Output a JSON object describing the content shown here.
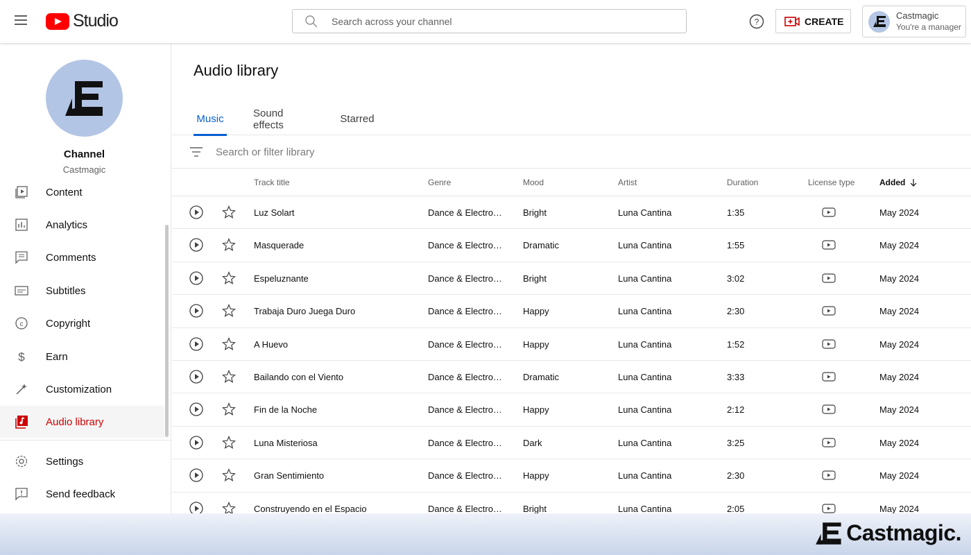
{
  "header": {
    "logo_text": "Studio",
    "search_placeholder": "Search across your channel",
    "create_label": "CREATE",
    "account_name": "Castmagic",
    "account_role": "You're a manager"
  },
  "sidebar": {
    "channel_title": "Channel",
    "channel_name": "Castmagic",
    "items": [
      {
        "label": "Content",
        "icon": "content-icon"
      },
      {
        "label": "Analytics",
        "icon": "analytics-icon"
      },
      {
        "label": "Comments",
        "icon": "comments-icon"
      },
      {
        "label": "Subtitles",
        "icon": "subtitles-icon"
      },
      {
        "label": "Copyright",
        "icon": "copyright-icon"
      },
      {
        "label": "Earn",
        "icon": "dollar-icon"
      },
      {
        "label": "Customization",
        "icon": "magic-wand-icon"
      },
      {
        "label": "Audio library",
        "icon": "audio-library-icon",
        "active": true
      },
      {
        "label": "Settings",
        "icon": "gear-icon"
      },
      {
        "label": "Send feedback",
        "icon": "feedback-icon"
      }
    ]
  },
  "main": {
    "page_title": "Audio library",
    "tabs": [
      {
        "label": "Music",
        "active": true
      },
      {
        "label": "Sound effects"
      },
      {
        "label": "Starred"
      }
    ],
    "filter_placeholder": "Search or filter library",
    "columns": [
      "Track title",
      "Genre",
      "Mood",
      "Artist",
      "Duration",
      "License type",
      "Added"
    ],
    "sorted_column": "Added",
    "tracks": [
      {
        "title": "Luz Solart",
        "genre": "Dance & Electro…",
        "mood": "Bright",
        "artist": "Luna Cantina",
        "duration": "1:35",
        "added": "May 2024"
      },
      {
        "title": "Masquerade",
        "genre": "Dance & Electro…",
        "mood": "Dramatic",
        "artist": "Luna Cantina",
        "duration": "1:55",
        "added": "May 2024"
      },
      {
        "title": "Espeluznante",
        "genre": "Dance & Electro…",
        "mood": "Bright",
        "artist": "Luna Cantina",
        "duration": "3:02",
        "added": "May 2024"
      },
      {
        "title": "Trabaja Duro Juega Duro",
        "genre": "Dance & Electro…",
        "mood": "Happy",
        "artist": "Luna Cantina",
        "duration": "2:30",
        "added": "May 2024"
      },
      {
        "title": "A Huevo",
        "genre": "Dance & Electro…",
        "mood": "Happy",
        "artist": "Luna Cantina",
        "duration": "1:52",
        "added": "May 2024"
      },
      {
        "title": "Bailando con el Viento",
        "genre": "Dance & Electro…",
        "mood": "Dramatic",
        "artist": "Luna Cantina",
        "duration": "3:33",
        "added": "May 2024"
      },
      {
        "title": "Fin de la Noche",
        "genre": "Dance & Electro…",
        "mood": "Happy",
        "artist": "Luna Cantina",
        "duration": "2:12",
        "added": "May 2024"
      },
      {
        "title": "Luna Misteriosa",
        "genre": "Dance & Electro…",
        "mood": "Dark",
        "artist": "Luna Cantina",
        "duration": "3:25",
        "added": "May 2024"
      },
      {
        "title": "Gran Sentimiento",
        "genre": "Dance & Electro…",
        "mood": "Happy",
        "artist": "Luna Cantina",
        "duration": "2:30",
        "added": "May 2024"
      },
      {
        "title": "Construyendo en el Espacio",
        "genre": "Dance & Electro…",
        "mood": "Bright",
        "artist": "Luna Cantina",
        "duration": "2:05",
        "added": "May 2024"
      }
    ]
  },
  "banner": {
    "brand": "Castmagic."
  },
  "colors": {
    "accent_blue": "#065fd4",
    "active_red": "#cc0000",
    "youtube_red": "#ff0000"
  }
}
